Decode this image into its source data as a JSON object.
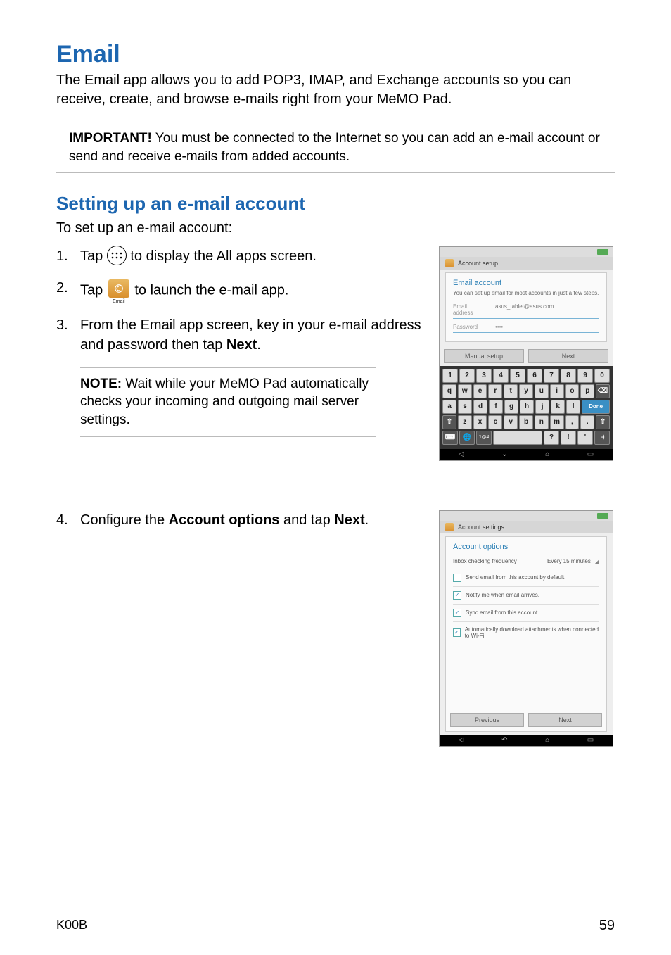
{
  "title": "Email",
  "intro": "The Email app allows you to add POP3, IMAP, and Exchange accounts so you can receive, create, and browse e-mails right from your MeMO Pad.",
  "important": {
    "label": "IMPORTANT!",
    "text": " You must be connected to the Internet so you can add an e-mail account or send and receive e-mails from added accounts."
  },
  "subhead": "Setting up an e-mail account",
  "lead": "To set up an e-mail account:",
  "steps": {
    "s1": {
      "num": "1.",
      "a": "Tap ",
      "b": " to display the All apps screen."
    },
    "s2": {
      "num": "2.",
      "a": "Tap ",
      "b": " to launch the e-mail app.",
      "icon_label": "Email"
    },
    "s3": {
      "num": "3.",
      "a": "From the Email app screen, key in your e-mail address and password then tap ",
      "bold": "Next",
      "b": "."
    },
    "s4": {
      "num": "4.",
      "a": "Configure the ",
      "bold1": "Account options",
      "mid": " and tap ",
      "bold2": "Next",
      "b": "."
    }
  },
  "note": {
    "label": "NOTE:",
    "text": " Wait while your MeMO Pad automatically checks your incoming and outgoing mail server settings."
  },
  "shot1": {
    "appbar": "Account setup",
    "panel_title": "Email account",
    "panel_sub": "You can set up email for most accounts in just a few steps.",
    "email_label": "Email address",
    "email_value": "asus_tablet@asus.com",
    "pwd_label": "Password",
    "pwd_value": "••••",
    "btn_manual": "Manual setup",
    "btn_next": "Next",
    "krow1": [
      "1",
      "2",
      "3",
      "4",
      "5",
      "6",
      "7",
      "8",
      "9",
      "0"
    ],
    "krow2": [
      "q",
      "w",
      "e",
      "r",
      "t",
      "y",
      "u",
      "i",
      "o",
      "p",
      "⌫"
    ],
    "krow3": [
      "a",
      "s",
      "d",
      "f",
      "g",
      "h",
      "j",
      "k",
      "l"
    ],
    "done": "Done",
    "krow4": [
      "⇧",
      "z",
      "x",
      "c",
      "v",
      "b",
      "n",
      "m",
      ",",
      ".",
      "⇧"
    ],
    "krow5": [
      "?",
      "!",
      "'",
      ":-)"
    ]
  },
  "shot2": {
    "appbar": "Account settings",
    "panel_title": "Account options",
    "freq_label": "Inbox checking frequency",
    "freq_value": "Every 15 minutes",
    "opt1": "Send email from this account by default.",
    "opt2": "Notify me when email arrives.",
    "opt3": "Sync email from this account.",
    "opt4": "Automatically download attachments when connected to Wi-Fi",
    "btn_prev": "Previous",
    "btn_next": "Next"
  },
  "footer": {
    "model": "K00B",
    "page": "59"
  }
}
